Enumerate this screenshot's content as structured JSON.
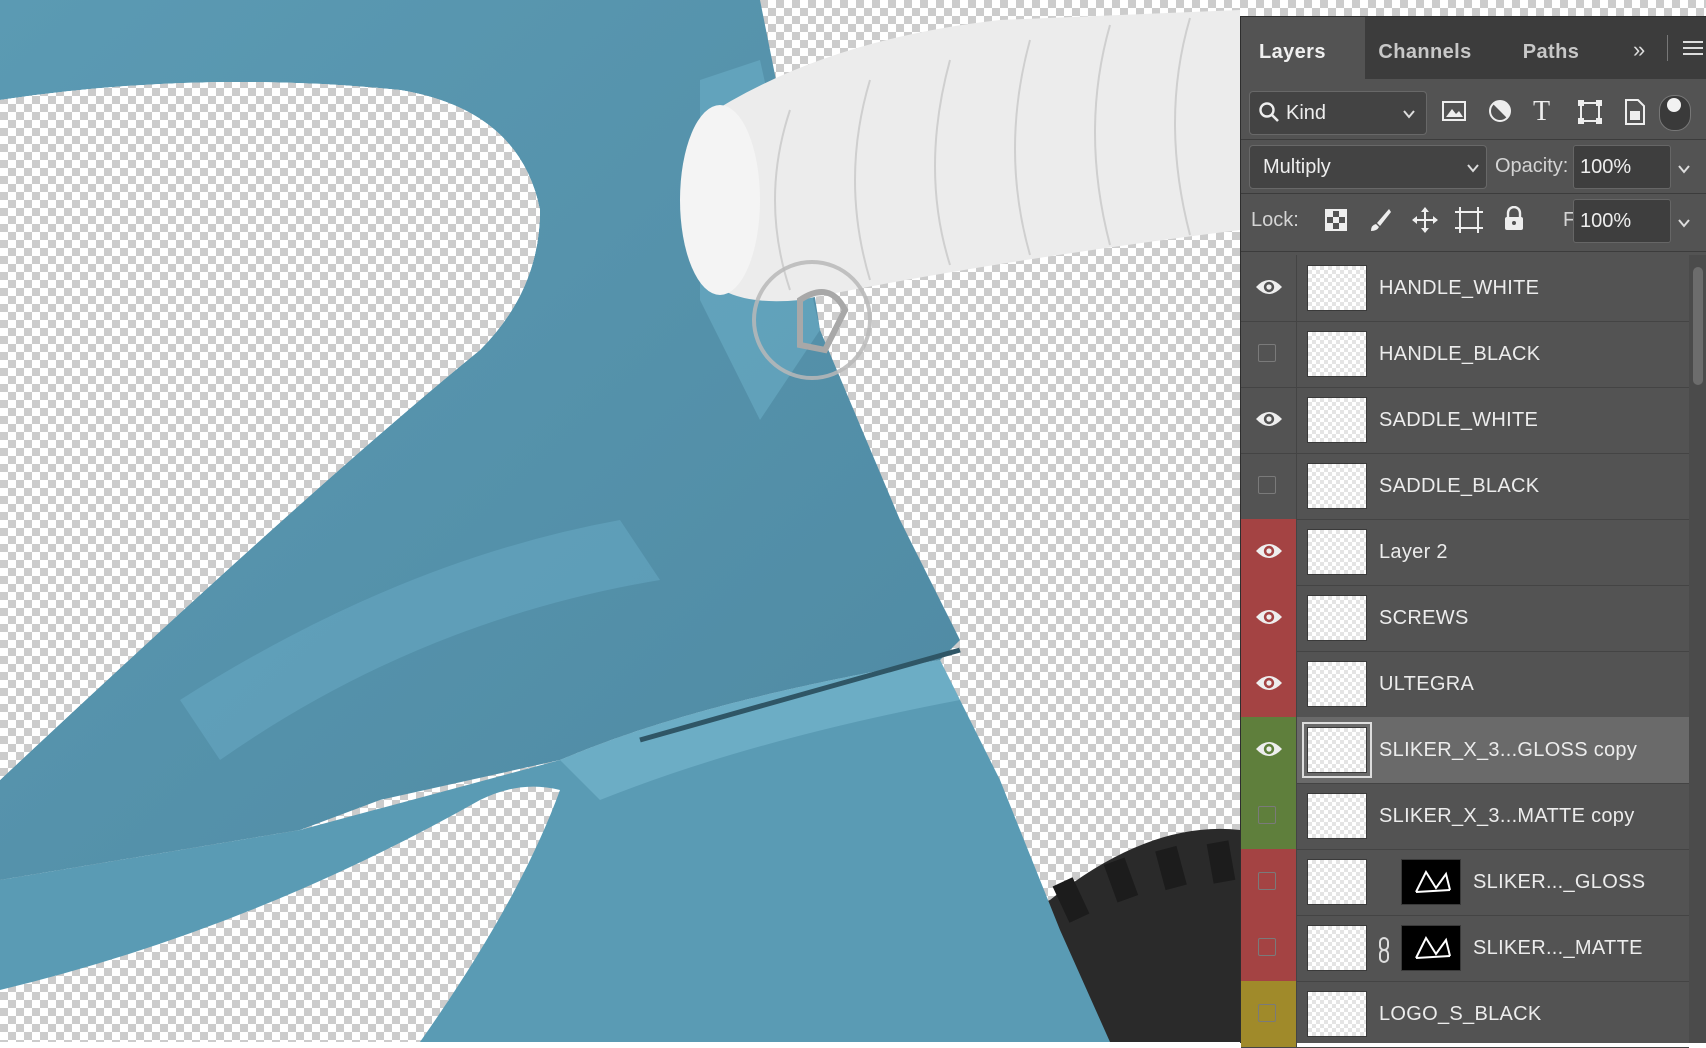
{
  "canvas": {
    "background": "transparent-checker"
  },
  "panel": {
    "tabs": [
      {
        "label": "Layers",
        "active": true
      },
      {
        "label": "Channels",
        "active": false
      },
      {
        "label": "Paths",
        "active": false
      }
    ],
    "collapse_icon": "double-chevron-right-icon",
    "menu_icon": "hamburger-menu-icon",
    "filter": {
      "label": "Kind",
      "icon": "search-icon"
    },
    "filter_icons": [
      "image-filter-icon",
      "adjustment-filter-icon",
      "type-filter-icon",
      "shape-filter-icon",
      "smart-object-filter-icon"
    ],
    "blend_mode": "Multiply",
    "opacity": {
      "label": "Opacity:",
      "value": "100%"
    },
    "lock": {
      "label": "Lock:",
      "icons": [
        "lock-transparent-pixels-icon",
        "lock-image-pixels-icon",
        "lock-position-icon",
        "lock-artboard-icon",
        "lock-all-icon"
      ]
    },
    "fill": {
      "label": "Fill:",
      "value": "100%"
    },
    "colors": {
      "panel": "#535353",
      "red_label": "#a44343",
      "green_label": "#5f7f3c",
      "yellow_label": "#a08a2a",
      "selected": "#6a6a6a",
      "frame": "#6aa6c2"
    },
    "layers": [
      {
        "name": "HANDLE_WHITE",
        "visible": true,
        "color": "none",
        "selected": false
      },
      {
        "name": "HANDLE_BLACK",
        "visible": false,
        "color": "none",
        "selected": false
      },
      {
        "name": "SADDLE_WHITE",
        "visible": true,
        "color": "none",
        "selected": false
      },
      {
        "name": "SADDLE_BLACK",
        "visible": false,
        "color": "none",
        "selected": false
      },
      {
        "name": "Layer 2",
        "visible": true,
        "color": "red",
        "selected": false
      },
      {
        "name": "SCREWS",
        "visible": true,
        "color": "red",
        "selected": false
      },
      {
        "name": "ULTEGRA",
        "visible": true,
        "color": "red",
        "selected": false
      },
      {
        "name": "SLIKER_X_3...GLOSS copy",
        "visible": true,
        "color": "green",
        "selected": true
      },
      {
        "name": "SLIKER_X_3...MATTE copy",
        "visible": false,
        "color": "green",
        "selected": false
      },
      {
        "name": "SLIKER..._GLOSS",
        "visible": false,
        "color": "red",
        "selected": false,
        "has_mask": true
      },
      {
        "name": "SLIKER..._MATTE",
        "visible": false,
        "color": "red",
        "selected": false,
        "has_mask": true,
        "linked": true
      },
      {
        "name": "LOGO_S_BLACK",
        "visible": false,
        "color": "yellow",
        "selected": false
      }
    ]
  }
}
